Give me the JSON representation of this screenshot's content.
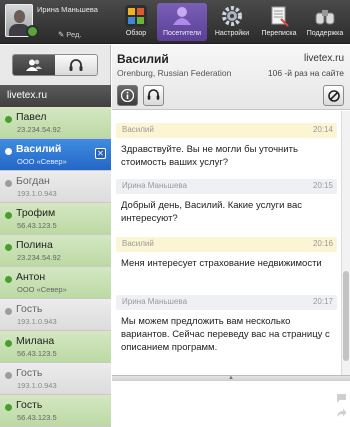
{
  "agent": {
    "name": "Ирина Маньшева",
    "edit_label": "Ред.",
    "status_color": "#5aa43a"
  },
  "toolbar": [
    {
      "label": "Обзор",
      "icon": "overview-grid-icon",
      "active": false
    },
    {
      "label": "Посетители",
      "icon": "visitors-icon",
      "active": true
    },
    {
      "label": "Настройки",
      "icon": "gear-icon",
      "active": false
    },
    {
      "label": "Переписка",
      "icon": "correspondence-icon",
      "active": false
    },
    {
      "label": "Поддержка",
      "icon": "binoculars-icon",
      "active": false
    }
  ],
  "sidebar": {
    "site": "livetex.ru",
    "clients": [
      {
        "name": "Павел",
        "sub": "23.234.54.92",
        "state": "green"
      },
      {
        "name": "Василий",
        "sub": "ООО «Север»",
        "state": "selected"
      },
      {
        "name": "Богдан",
        "sub": "193.1.0.943",
        "state": "gray"
      },
      {
        "name": "Трофим",
        "sub": "56.43.123.5",
        "state": "green"
      },
      {
        "name": "Полина",
        "sub": "23.234.54.92",
        "state": "green"
      },
      {
        "name": "Антон",
        "sub": "ООО «Север»",
        "state": "green"
      },
      {
        "name": "Гость",
        "sub": "193.1.0.943",
        "state": "gray"
      },
      {
        "name": "Милана",
        "sub": "56.43.123.5",
        "state": "green"
      },
      {
        "name": "Гость",
        "sub": "193.1.0.943",
        "state": "gray"
      },
      {
        "name": "Гость",
        "sub": "56.43.123.5",
        "state": "green"
      }
    ]
  },
  "chat": {
    "visitor_name": "Василий",
    "visitor_site": "livetex.ru",
    "location": "Orenburg, Russian Federation",
    "visit_info": "106 -й раз на сайте",
    "messages": [
      {
        "author": "Василий",
        "time": "20:14",
        "kind": "v",
        "text": "Здравствуйте. Вы не могли бы уточнить стоимость ваших услуг?"
      },
      {
        "author": "Ирина Маньшева",
        "time": "20:15",
        "kind": "o",
        "text": "Добрый день, Василий. Какие услуги вас интересуют?"
      },
      {
        "author": "Василий",
        "time": "20:16",
        "kind": "v",
        "text": "Меня интересует страхование недвижимости"
      },
      {
        "author": "Ирина Маньшева",
        "time": "20:17",
        "kind": "o",
        "text": "Мы можем предложить вам несколько вариантов. Сейчас переведу вас на страницу с описанием программ."
      }
    ]
  }
}
